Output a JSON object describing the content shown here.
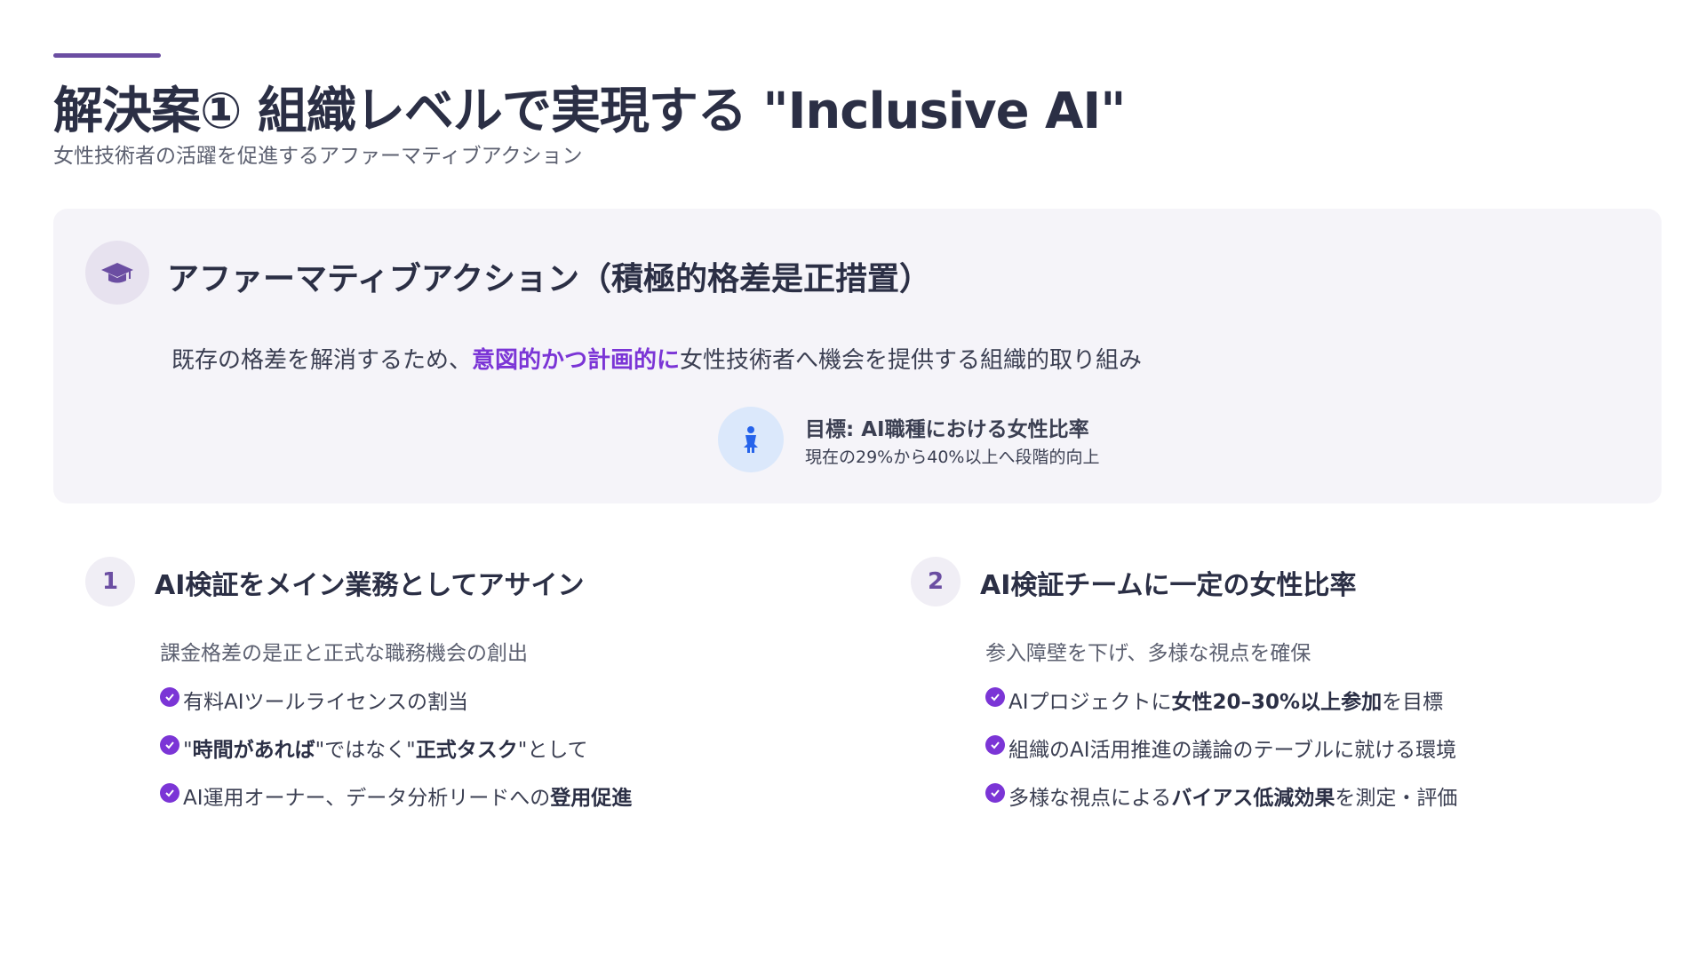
{
  "header": {
    "title": "解決案① 組織レベルで実現する \"Inclusive AI\"",
    "subtitle": "女性技術者の活躍を促進するアファーマティブアクション"
  },
  "hero": {
    "icon": "graduation-cap-icon",
    "title": "アファーマティブアクション（積極的格差是正措置）",
    "desc_before": "既存の格差を解消するため、",
    "desc_highlight": "意図的かつ計画的に",
    "desc_after": "女性技術者へ機会を提供する組織的取り組み",
    "goal": {
      "icon": "person-icon",
      "title": "目標: AI職種における女性比率",
      "sub": "現在の29%から40%以上へ段階的向上"
    }
  },
  "columns": [
    {
      "number": "1",
      "title": "AI検証をメイン業務としてアサイン",
      "desc": "課金格差の是正と正式な職務機会の創出",
      "bullets": [
        {
          "pre": "有料AIツールライセンスの割当",
          "bold": "",
          "post": ""
        },
        {
          "pre": "\"",
          "bold": "時間があれば",
          "post": "\"ではなく\"",
          "bold2": "正式タスク",
          "post2": "\"として"
        },
        {
          "pre": "AI運用オーナー、データ分析リードへの",
          "bold": "登用促進",
          "post": ""
        }
      ]
    },
    {
      "number": "2",
      "title": "AI検証チームに一定の女性比率",
      "desc": "参入障壁を下げ、多様な視点を確保",
      "bullets": [
        {
          "pre": "AIプロジェクトに",
          "bold": "女性20–30%以上参加",
          "post": "を目標"
        },
        {
          "pre": "組織のAI活用推進の議論のテーブルに就ける環境",
          "bold": "",
          "post": ""
        },
        {
          "pre": "多様な視点による",
          "bold": "バイアス低減効果",
          "post": "を測定・評価"
        }
      ]
    }
  ],
  "colors": {
    "accent": "#6b4ea2",
    "highlight": "#7b35d6",
    "goal_icon_bg": "#dbe8fb",
    "goal_icon": "#2563eb"
  }
}
